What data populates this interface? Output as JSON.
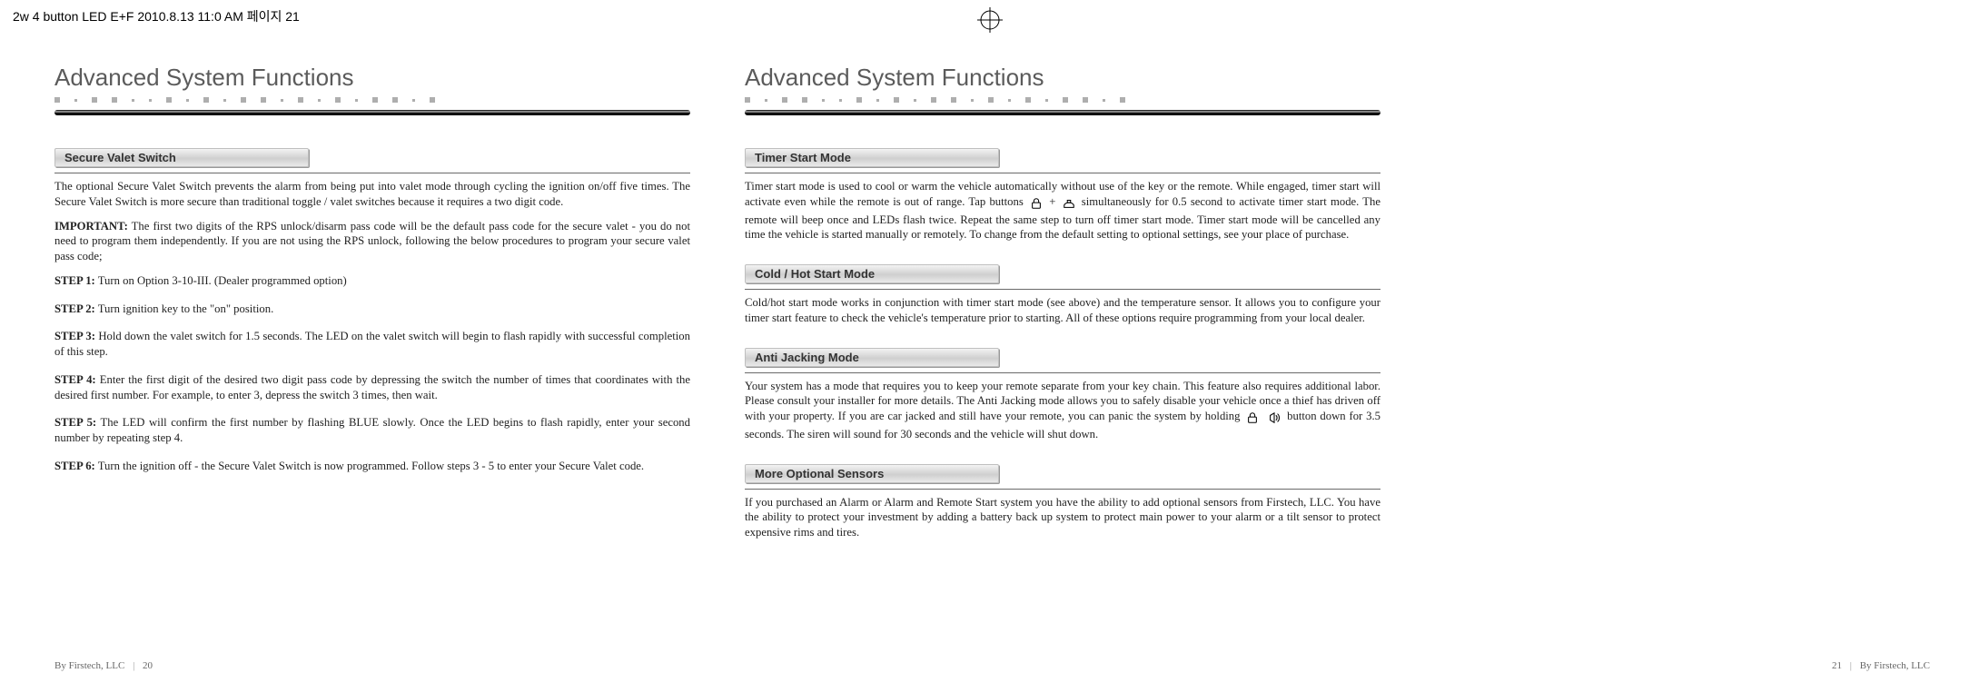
{
  "print_header": "2w 4 button LED E+F  2010.8.13 11:0 AM  페이지 21",
  "left": {
    "title": "Advanced System Functions",
    "subhead1": "Secure Valet Switch",
    "intro1": "The optional Secure Valet Switch prevents the alarm from being put into valet mode through cycling the ignition on/off five times. The Secure Valet Switch is more secure than traditional toggle / valet switches because it requires a two digit code.",
    "important_label": "IMPORTANT:",
    "important_text": " The first two digits of the RPS unlock/disarm pass code will be the default pass code for the secure valet - you do not need to program them independently. If you are not using the RPS unlock, following the below procedures to program your secure valet pass code;",
    "steps": [
      {
        "label": "STEP 1:",
        "text": " Turn on Option 3-10-III. (Dealer programmed option)"
      },
      {
        "label": "STEP 2:",
        "text": " Turn ignition key to the \"on\" position."
      },
      {
        "label": "STEP 3:",
        "text": " Hold down the valet switch for 1.5 seconds. The LED on the valet switch will begin to flash rapidly with successful completion of this step."
      },
      {
        "label": "STEP 4:",
        "text": " Enter the first digit of the desired two digit pass code by depressing the switch the number of times that coordinates with the desired first number. For example, to enter 3, depress the switch 3 times, then wait."
      },
      {
        "label": "STEP 5:",
        "text": " The  LED  will confirm the first number by flashing BLUE slowly. Once the LED begins to flash rapidly, enter your second number by repeating step 4."
      },
      {
        "label": "STEP 6:",
        "text": " Turn the ignition off - the Secure Valet Switch is now programmed. Follow steps 3 - 5 to enter your Secure Valet code."
      }
    ]
  },
  "right": {
    "title": "Advanced System Functions",
    "sections": [
      {
        "head": "Timer Start Mode",
        "body_pre": "Timer start mode is used to cool or warm the vehicle automatically without use of the key or the remote. While engaged, timer start will activate even while the remote is out of range. Tap buttons ",
        "body_post": " simultaneously for 0.5 second to activate timer start mode. The remote will beep once and LEDs flash twice. Repeat the same step to turn off timer start mode. Timer start mode will be cancelled any time the vehicle is started manually or remotely. To change from the default setting to optional settings, see your place of purchase.",
        "icons": "lock-trunk"
      },
      {
        "head": "Cold / Hot Start Mode",
        "body": "Cold/hot start mode works in conjunction with timer start mode (see above) and the temperature sensor.  It allows you to configure your timer start feature to check the vehicle's temperature prior to starting.  All of these options require programming from your local dealer."
      },
      {
        "head": "Anti Jacking Mode",
        "body_pre": "Your system has a mode that requires you to keep your remote separate from your key chain. This feature also requires additional labor. Please consult your installer for more details. The Anti Jacking mode allows you to safely disable your vehicle once a thief has driven off with your property. If you are car jacked and still have your remote, you can panic the system by holding ",
        "body_post": " button  down for 3.5 seconds. The siren will sound for 30 seconds and the vehicle will shut down.",
        "icons": "lock-siren"
      },
      {
        "head": "More Optional Sensors",
        "body": "If you purchased an Alarm or Alarm and Remote Start system you have the ability to add optional sensors from Firstech, LLC. You have the ability to protect your investment by adding a battery back up system to protect main power to your alarm or a tilt sensor to protect expensive rims and tires."
      }
    ]
  },
  "footer": {
    "by": "By Firstech, LLC",
    "left_page": "20",
    "right_page": "21"
  }
}
